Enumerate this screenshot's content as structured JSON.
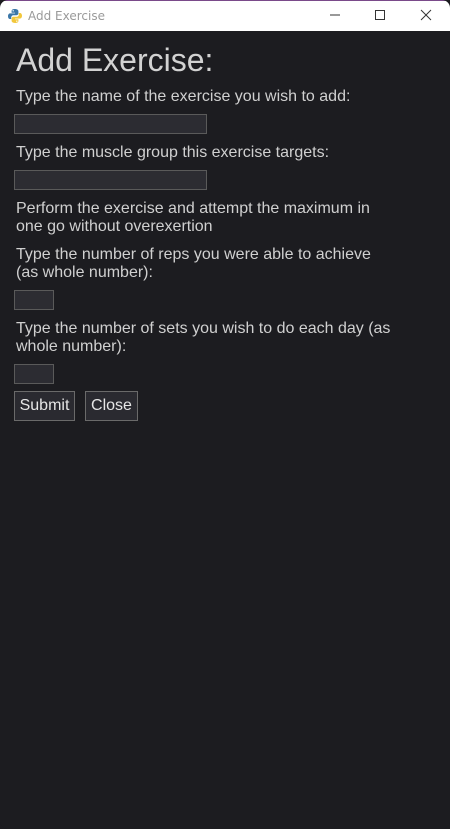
{
  "window": {
    "title": "Add Exercise",
    "controls": {
      "minimize": "minimize-icon",
      "maximize": "maximize-icon",
      "close": "close-icon"
    }
  },
  "form": {
    "heading": "Add Exercise:",
    "name_prompt": "Type the name of the exercise you wish to add:",
    "name_value": "",
    "muscle_prompt": "Type the muscle group this exercise targets:",
    "muscle_value": "",
    "instruction": "Perform the exercise and attempt the maximum in one go without overexertion",
    "reps_prompt": "Type the number of reps you were able to achieve (as whole number):",
    "reps_value": "",
    "sets_prompt": "Type the number of sets you wish to do each day (as whole number):",
    "sets_value": ""
  },
  "buttons": {
    "submit": "Submit",
    "close": "Close"
  },
  "colors": {
    "background": "#1c1c20",
    "text": "#d0d0d0",
    "field": "#2c2c32",
    "titlebar": "#ffffff"
  }
}
